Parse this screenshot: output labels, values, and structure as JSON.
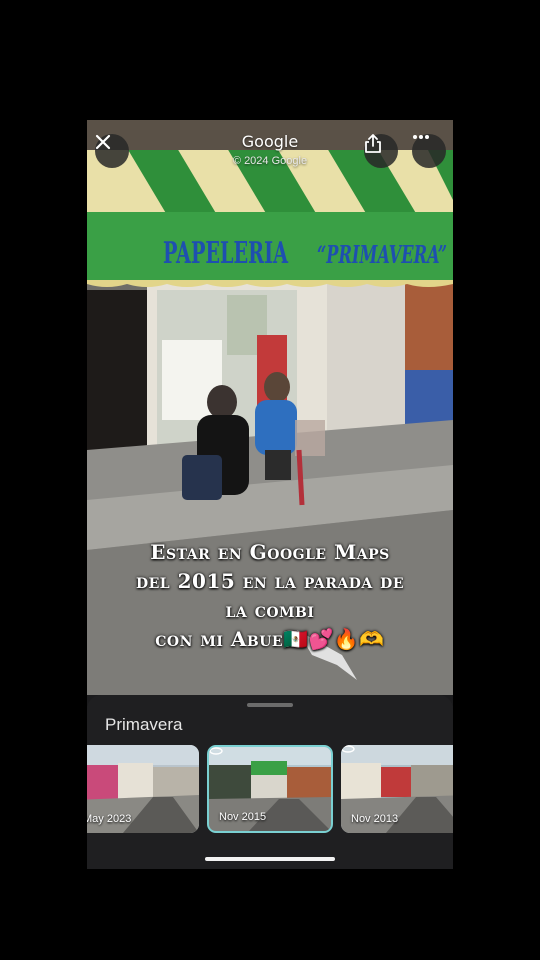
{
  "header": {
    "title": "Google",
    "copyright": "© 2024 Google"
  },
  "storefront": {
    "sign_left": "PAPELERIA",
    "sign_right": "“PRIMAVERA”"
  },
  "caption": {
    "line1": "Estar en Google Maps",
    "line2": "del 2015 en la parada de",
    "line3": "la combi",
    "line4": "con mi Abue🇲🇽💕🔥🫶"
  },
  "sheet": {
    "title": "Primavera",
    "thumbnails": [
      {
        "label": "May 2023"
      },
      {
        "label": "Nov 2015"
      },
      {
        "label": "Nov 2013"
      }
    ]
  },
  "icons": {
    "close": "close-icon",
    "share": "share-icon",
    "more": "more-icon",
    "streetview": "360-icon"
  },
  "colors": {
    "awning_green": "#2f8f3a",
    "sign_blue": "#1e4fb0",
    "selected_border": "#7ad0d2"
  }
}
